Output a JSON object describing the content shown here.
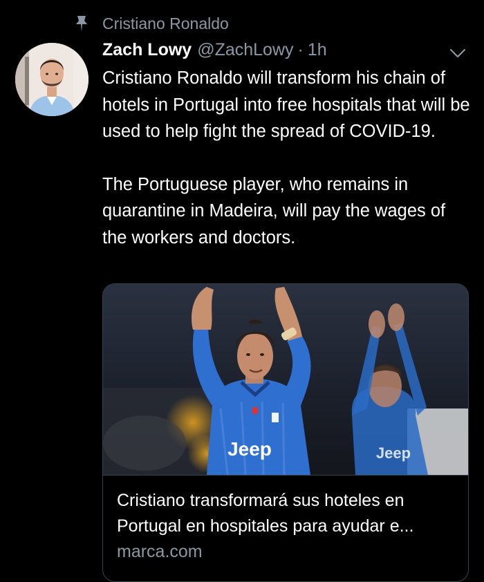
{
  "context": {
    "icon": "pin-icon",
    "label": "Cristiano Ronaldo"
  },
  "tweet": {
    "author_name": "Zach Lowy",
    "author_handle": "@ZachLowy",
    "separator": "·",
    "time": "1h",
    "paragraphs": [
      "Cristiano Ronaldo will transform his chain of hotels in Portugal into free hospitals that will be used to help fight the spread of COVID-19.",
      "The Portuguese player, who remains in quarantine in Madeira, will pay the wages of the workers and doctors."
    ]
  },
  "card": {
    "title": "Cristiano transformará sus hoteles en Portugal en hospitales para ayudar e...",
    "domain": "marca.com",
    "jersey_text": "Jeep"
  },
  "colors": {
    "background": "#000000",
    "primary_text": "#ffffff",
    "secondary_text": "#8b98a5",
    "border": "#38444d",
    "jersey_blue": "#2a6bc4"
  }
}
